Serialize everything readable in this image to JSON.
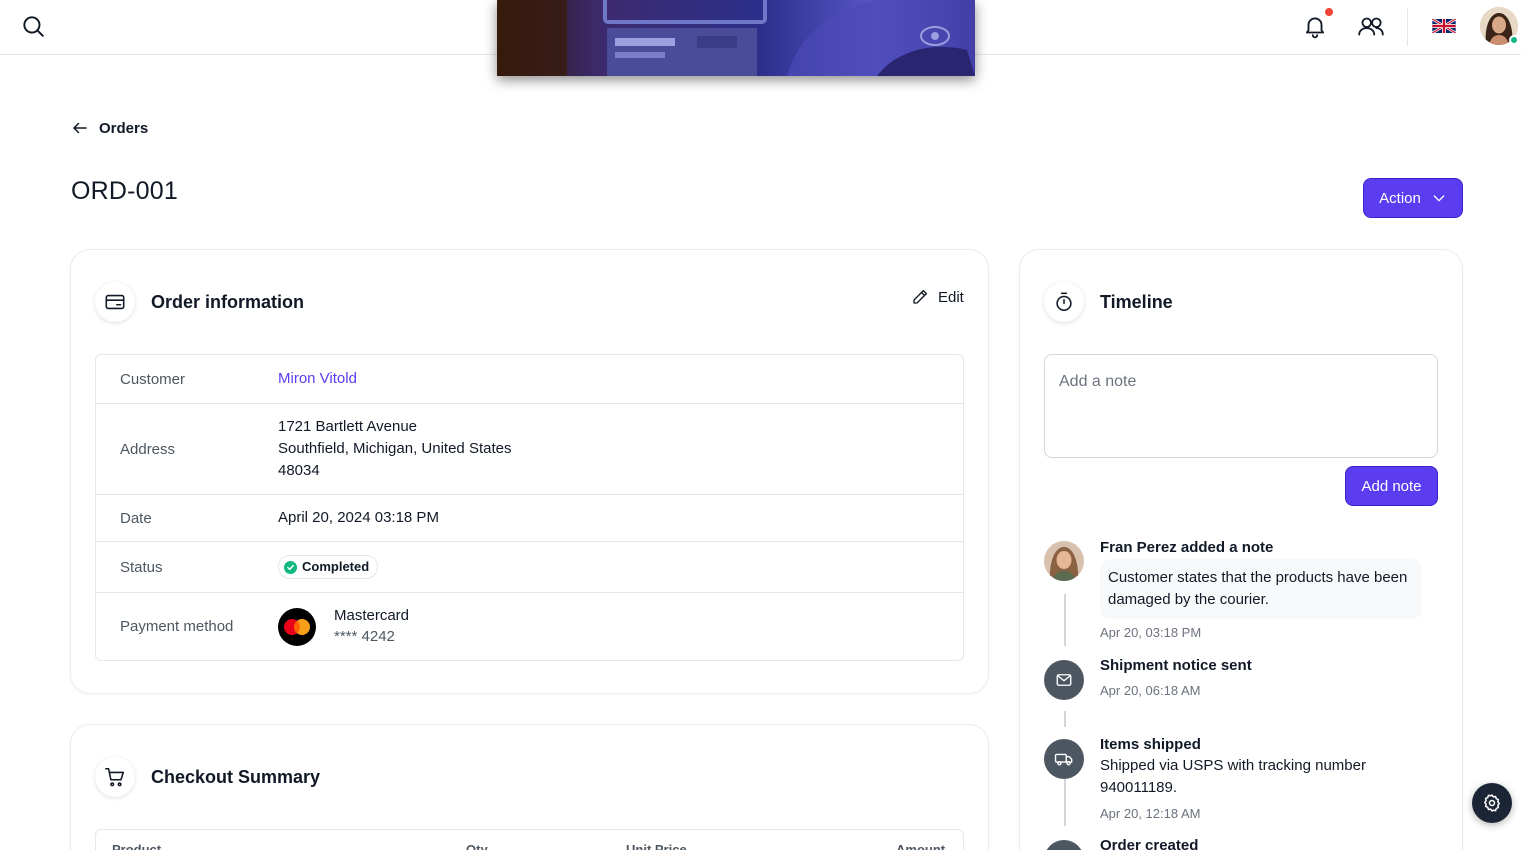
{
  "header": {
    "search_icon": "search-icon",
    "notifications_icon": "bell-icon",
    "contacts_icon": "users-icon",
    "language_flag": "uk-flag",
    "avatar": "user-avatar"
  },
  "nav": {
    "back_label": "Orders"
  },
  "page": {
    "title": "ORD-001",
    "action_label": "Action"
  },
  "order_info": {
    "title": "Order information",
    "edit_label": "Edit",
    "rows": {
      "customer_label": "Customer",
      "customer_value": "Miron Vitold",
      "address_label": "Address",
      "address_line1": "1721 Bartlett Avenue",
      "address_line2": "Southfield, Michigan, United States",
      "address_line3": "48034",
      "date_label": "Date",
      "date_value": "April 20, 2024 03:18 PM",
      "status_label": "Status",
      "status_value": "Completed",
      "payment_label": "Payment method",
      "payment_brand": "Mastercard",
      "payment_number": "**** 4242"
    }
  },
  "checkout": {
    "title": "Checkout Summary",
    "columns": [
      "Product",
      "Qty",
      "Unit Price",
      "Amount"
    ]
  },
  "timeline": {
    "title": "Timeline",
    "note_placeholder": "Add a note",
    "add_note_label": "Add note",
    "events": [
      {
        "title": "Fran Perez added a note",
        "note": "Customer states that the products have been damaged by the courier.",
        "date": "Apr 20, 03:18 PM"
      },
      {
        "title": "Shipment notice sent",
        "date": "Apr 20, 06:18 AM"
      },
      {
        "title": "Items shipped",
        "text": "Shipped via USPS with tracking number 940011189.",
        "date": "Apr 20, 12:18 AM"
      },
      {
        "title": "Order created"
      }
    ]
  },
  "colors": {
    "primary": "#5b3cf0",
    "success": "#10b981",
    "danger": "#f04438",
    "dark": "#1c2536"
  }
}
